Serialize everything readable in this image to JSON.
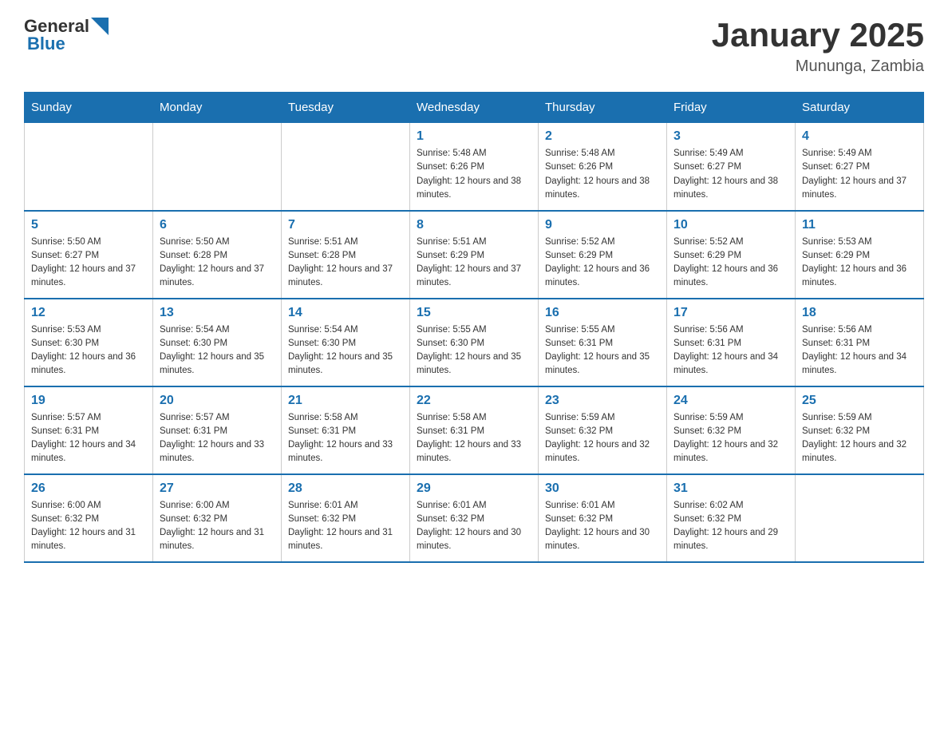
{
  "header": {
    "logo_general": "General",
    "logo_blue": "Blue",
    "title": "January 2025",
    "subtitle": "Mununga, Zambia"
  },
  "days_of_week": [
    "Sunday",
    "Monday",
    "Tuesday",
    "Wednesday",
    "Thursday",
    "Friday",
    "Saturday"
  ],
  "weeks": [
    [
      {
        "day": "",
        "info": ""
      },
      {
        "day": "",
        "info": ""
      },
      {
        "day": "",
        "info": ""
      },
      {
        "day": "1",
        "info": "Sunrise: 5:48 AM\nSunset: 6:26 PM\nDaylight: 12 hours and 38 minutes."
      },
      {
        "day": "2",
        "info": "Sunrise: 5:48 AM\nSunset: 6:26 PM\nDaylight: 12 hours and 38 minutes."
      },
      {
        "day": "3",
        "info": "Sunrise: 5:49 AM\nSunset: 6:27 PM\nDaylight: 12 hours and 38 minutes."
      },
      {
        "day": "4",
        "info": "Sunrise: 5:49 AM\nSunset: 6:27 PM\nDaylight: 12 hours and 37 minutes."
      }
    ],
    [
      {
        "day": "5",
        "info": "Sunrise: 5:50 AM\nSunset: 6:27 PM\nDaylight: 12 hours and 37 minutes."
      },
      {
        "day": "6",
        "info": "Sunrise: 5:50 AM\nSunset: 6:28 PM\nDaylight: 12 hours and 37 minutes."
      },
      {
        "day": "7",
        "info": "Sunrise: 5:51 AM\nSunset: 6:28 PM\nDaylight: 12 hours and 37 minutes."
      },
      {
        "day": "8",
        "info": "Sunrise: 5:51 AM\nSunset: 6:29 PM\nDaylight: 12 hours and 37 minutes."
      },
      {
        "day": "9",
        "info": "Sunrise: 5:52 AM\nSunset: 6:29 PM\nDaylight: 12 hours and 36 minutes."
      },
      {
        "day": "10",
        "info": "Sunrise: 5:52 AM\nSunset: 6:29 PM\nDaylight: 12 hours and 36 minutes."
      },
      {
        "day": "11",
        "info": "Sunrise: 5:53 AM\nSunset: 6:29 PM\nDaylight: 12 hours and 36 minutes."
      }
    ],
    [
      {
        "day": "12",
        "info": "Sunrise: 5:53 AM\nSunset: 6:30 PM\nDaylight: 12 hours and 36 minutes."
      },
      {
        "day": "13",
        "info": "Sunrise: 5:54 AM\nSunset: 6:30 PM\nDaylight: 12 hours and 35 minutes."
      },
      {
        "day": "14",
        "info": "Sunrise: 5:54 AM\nSunset: 6:30 PM\nDaylight: 12 hours and 35 minutes."
      },
      {
        "day": "15",
        "info": "Sunrise: 5:55 AM\nSunset: 6:30 PM\nDaylight: 12 hours and 35 minutes."
      },
      {
        "day": "16",
        "info": "Sunrise: 5:55 AM\nSunset: 6:31 PM\nDaylight: 12 hours and 35 minutes."
      },
      {
        "day": "17",
        "info": "Sunrise: 5:56 AM\nSunset: 6:31 PM\nDaylight: 12 hours and 34 minutes."
      },
      {
        "day": "18",
        "info": "Sunrise: 5:56 AM\nSunset: 6:31 PM\nDaylight: 12 hours and 34 minutes."
      }
    ],
    [
      {
        "day": "19",
        "info": "Sunrise: 5:57 AM\nSunset: 6:31 PM\nDaylight: 12 hours and 34 minutes."
      },
      {
        "day": "20",
        "info": "Sunrise: 5:57 AM\nSunset: 6:31 PM\nDaylight: 12 hours and 33 minutes."
      },
      {
        "day": "21",
        "info": "Sunrise: 5:58 AM\nSunset: 6:31 PM\nDaylight: 12 hours and 33 minutes."
      },
      {
        "day": "22",
        "info": "Sunrise: 5:58 AM\nSunset: 6:31 PM\nDaylight: 12 hours and 33 minutes."
      },
      {
        "day": "23",
        "info": "Sunrise: 5:59 AM\nSunset: 6:32 PM\nDaylight: 12 hours and 32 minutes."
      },
      {
        "day": "24",
        "info": "Sunrise: 5:59 AM\nSunset: 6:32 PM\nDaylight: 12 hours and 32 minutes."
      },
      {
        "day": "25",
        "info": "Sunrise: 5:59 AM\nSunset: 6:32 PM\nDaylight: 12 hours and 32 minutes."
      }
    ],
    [
      {
        "day": "26",
        "info": "Sunrise: 6:00 AM\nSunset: 6:32 PM\nDaylight: 12 hours and 31 minutes."
      },
      {
        "day": "27",
        "info": "Sunrise: 6:00 AM\nSunset: 6:32 PM\nDaylight: 12 hours and 31 minutes."
      },
      {
        "day": "28",
        "info": "Sunrise: 6:01 AM\nSunset: 6:32 PM\nDaylight: 12 hours and 31 minutes."
      },
      {
        "day": "29",
        "info": "Sunrise: 6:01 AM\nSunset: 6:32 PM\nDaylight: 12 hours and 30 minutes."
      },
      {
        "day": "30",
        "info": "Sunrise: 6:01 AM\nSunset: 6:32 PM\nDaylight: 12 hours and 30 minutes."
      },
      {
        "day": "31",
        "info": "Sunrise: 6:02 AM\nSunset: 6:32 PM\nDaylight: 12 hours and 29 minutes."
      },
      {
        "day": "",
        "info": ""
      }
    ]
  ]
}
